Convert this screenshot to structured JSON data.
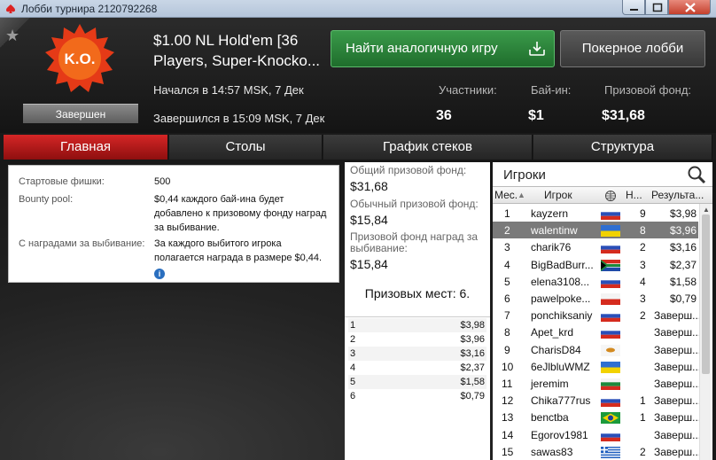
{
  "window": {
    "title": "Лобби турнира 2120792268"
  },
  "header": {
    "logo_text": "K.O.",
    "status": "Завершен",
    "title_line1": "$1.00 NL Hold'em [36",
    "title_line2": "Players, Super-Knocko...",
    "find_button": "Найти аналогичную игру",
    "lobby_button": "Покерное лобби",
    "started": "Начался в 14:57 MSK, 7 Дек",
    "finished": "Завершился в 15:09 MSK, 7 Дек",
    "participants_label": "Участники:",
    "participants_value": "36",
    "buyin_label": "Бай-ин:",
    "buyin_value": "$1",
    "prize_label": "Призовой фонд:",
    "prize_value": "$31,68"
  },
  "tabs": [
    {
      "label": "Главная",
      "active": true
    },
    {
      "label": "Столы",
      "active": false
    },
    {
      "label": "График стеков",
      "active": false
    },
    {
      "label": "Структура",
      "active": false
    }
  ],
  "main": {
    "starting_chips_label": "Стартовые фишки:",
    "starting_chips_value": "500",
    "bounty_label": "Bounty pool:",
    "bounty_value": "$0,44 каждого бай-ина будет добавлено к призовому фонду наград за выбивание.",
    "ko_label": "С наградами за выбивание:",
    "ko_value": "За каждого выбитого игрока полагается награда в размере $0,44."
  },
  "prizes": {
    "total_label": "Общий призовой фонд:",
    "total_value": "$31,68",
    "regular_label": "Обычный призовой фонд:",
    "regular_value": "$15,84",
    "bounty_label": "Призовой фонд наград за выбивание:",
    "bounty_value": "$15,84",
    "places": "Призовых мест: 6.",
    "payouts": [
      {
        "place": "1",
        "amount": "$3,98"
      },
      {
        "place": "2",
        "amount": "$3,96"
      },
      {
        "place": "3",
        "amount": "$3,16"
      },
      {
        "place": "4",
        "amount": "$2,37"
      },
      {
        "place": "5",
        "amount": "$1,58"
      },
      {
        "place": "6",
        "amount": "$0,79"
      }
    ]
  },
  "players": {
    "title": "Игроки",
    "columns": [
      "Мес.",
      "Игрок",
      "",
      "Н...",
      "Результа..."
    ],
    "rows": [
      {
        "place": "1",
        "name": "kayzern",
        "flag": "ru",
        "n": "9",
        "result": "$3,98"
      },
      {
        "place": "2",
        "name": "walentinw",
        "flag": "ua",
        "n": "8",
        "result": "$3,96",
        "selected": true
      },
      {
        "place": "3",
        "name": "charik76",
        "flag": "ru",
        "n": "2",
        "result": "$3,16"
      },
      {
        "place": "4",
        "name": "BigBadBurr...",
        "flag": "za",
        "n": "3",
        "result": "$2,37"
      },
      {
        "place": "5",
        "name": "elena3108...",
        "flag": "ru",
        "n": "4",
        "result": "$1,58"
      },
      {
        "place": "6",
        "name": "pawelpoke...",
        "flag": "pl",
        "n": "3",
        "result": "$0,79"
      },
      {
        "place": "7",
        "name": "ponchiksaniy",
        "flag": "ru",
        "n": "2",
        "result": "Заверш..."
      },
      {
        "place": "8",
        "name": "Apet_krd",
        "flag": "ru",
        "n": "",
        "result": "Заверш..."
      },
      {
        "place": "9",
        "name": "CharisD84",
        "flag": "cy",
        "n": "",
        "result": "Заверш..."
      },
      {
        "place": "10",
        "name": "6eJlbluWMZ",
        "flag": "ua",
        "n": "",
        "result": "Заверш..."
      },
      {
        "place": "11",
        "name": "jeremim",
        "flag": "bg",
        "n": "",
        "result": "Заверш..."
      },
      {
        "place": "12",
        "name": "Chika777rus",
        "flag": "ru",
        "n": "1",
        "result": "Заверш..."
      },
      {
        "place": "13",
        "name": "benctba",
        "flag": "br",
        "n": "1",
        "result": "Заверш..."
      },
      {
        "place": "14",
        "name": "Egorov1981",
        "flag": "ru",
        "n": "",
        "result": "Заверш..."
      },
      {
        "place": "15",
        "name": "sawas83",
        "flag": "gr",
        "n": "2",
        "result": "Заверш..."
      }
    ]
  }
}
